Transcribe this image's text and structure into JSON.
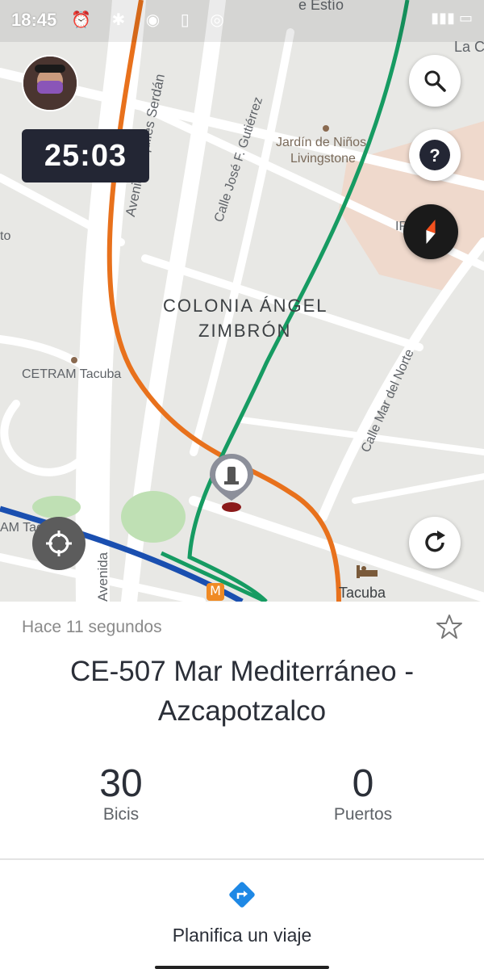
{
  "status_bar": {
    "time": "18:45",
    "icons": "⏰ ✱ ◉ ▯ ◎",
    "right": "▮▮▮ ▭"
  },
  "map": {
    "timer": "25:03",
    "labels": {
      "la_co": "La Co",
      "estio": "e Estío",
      "jardin": "Jardín de Niños",
      "jardin2": "Livingstone",
      "colonia": "COLONIA ÁNGEL",
      "colonia2": "ZIMBRÓN",
      "cetram": "CETRAM Tacuba",
      "cetram2": "AM Tacuba",
      "tacuba": "Tacuba",
      "calle_gutierrez": "Calle José F. Gutiérrez",
      "av_serdan": "Avenida Aquiles Serdán",
      "calle_mar_norte": "Calle Mar del Norte",
      "avenida": "Avenida",
      "ip": "IP",
      "to": "to"
    },
    "colors": {
      "orange_route": "#e8711c",
      "green_route": "#169b62",
      "blue_route": "#1a4fb0"
    },
    "icons": [
      "search-icon",
      "help-icon",
      "compass-icon",
      "refresh-icon",
      "locate-icon",
      "station-pin-icon",
      "metro-icon",
      "hotel-icon"
    ]
  },
  "panel": {
    "updated": "Hace 11 segundos",
    "station_line1": "CE-507 Mar Mediterráneo -",
    "station_line2": "Azcapotzalco",
    "bikes_count": "30",
    "bikes_label": "Bicis",
    "docks_count": "0",
    "docks_label": "Puertos",
    "plan_label": "Planifica un viaje"
  }
}
